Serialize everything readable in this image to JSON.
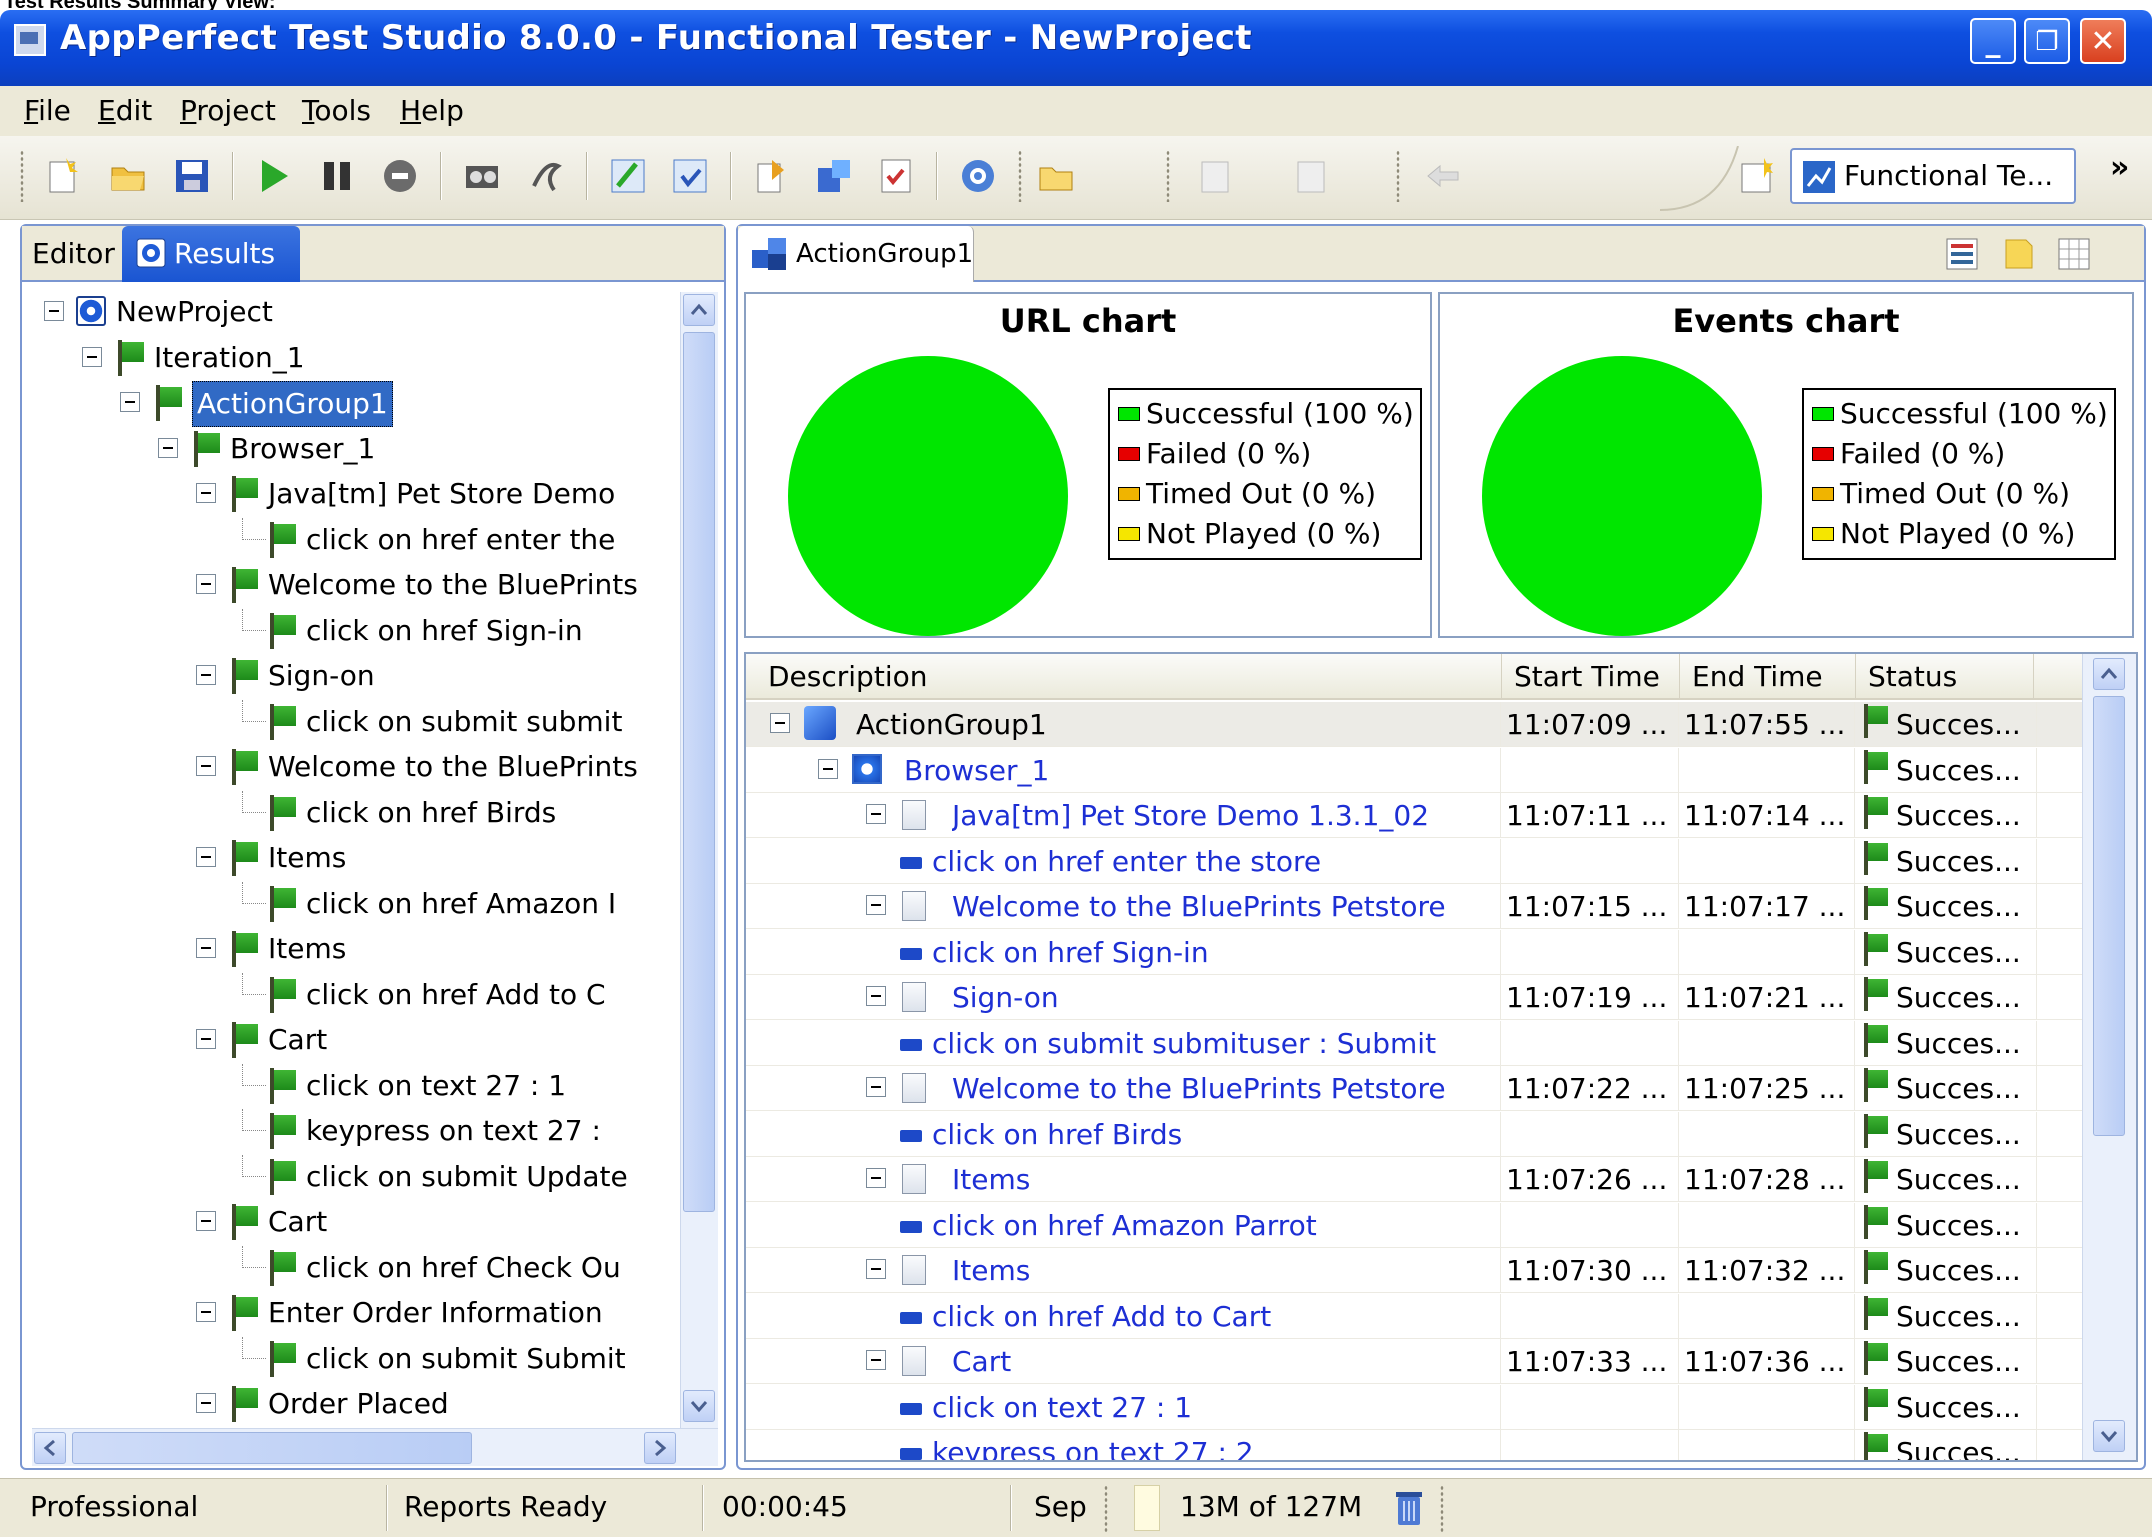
{
  "caption": "Test Results Summary View:",
  "window": {
    "title": "AppPerfect Test Studio 8.0.0 - Functional Tester - NewProject",
    "min_glyph": "_",
    "max_glyph": "❐",
    "close_glyph": "✕"
  },
  "menu": [
    "File",
    "Edit",
    "Project",
    "Tools",
    "Help"
  ],
  "toolbar": {
    "perspective_label": "Functional Te...",
    "overflow_glyph": "»"
  },
  "left_tabs": {
    "editor": "Editor",
    "results": "Results"
  },
  "tree": [
    {
      "label": "NewProject",
      "level": 0,
      "icon": "project-icon",
      "expander": true
    },
    {
      "label": "Iteration_1",
      "level": 1,
      "icon": "flag-icon",
      "expander": true
    },
    {
      "label": "ActionGroup1",
      "level": 2,
      "icon": "flag-icon",
      "expander": true,
      "selected": true
    },
    {
      "label": "Browser_1",
      "level": 3,
      "icon": "flag-icon",
      "expander": true
    },
    {
      "label": "Java[tm] Pet Store Demo",
      "level": 4,
      "icon": "flag-icon",
      "expander": true
    },
    {
      "label": "click on href enter the",
      "level": 5,
      "icon": "flag-icon",
      "expander": false
    },
    {
      "label": "Welcome to the BluePrints",
      "level": 4,
      "icon": "flag-icon",
      "expander": true
    },
    {
      "label": "click on href Sign-in",
      "level": 5,
      "icon": "flag-icon",
      "expander": false
    },
    {
      "label": "Sign-on",
      "level": 4,
      "icon": "flag-icon",
      "expander": true
    },
    {
      "label": "click on submit submit",
      "level": 5,
      "icon": "flag-icon",
      "expander": false
    },
    {
      "label": "Welcome to the BluePrints",
      "level": 4,
      "icon": "flag-icon",
      "expander": true
    },
    {
      "label": "click on href Birds",
      "level": 5,
      "icon": "flag-icon",
      "expander": false
    },
    {
      "label": "Items",
      "level": 4,
      "icon": "flag-icon",
      "expander": true
    },
    {
      "label": "click on href Amazon I",
      "level": 5,
      "icon": "flag-icon",
      "expander": false
    },
    {
      "label": "Items",
      "level": 4,
      "icon": "flag-icon",
      "expander": true
    },
    {
      "label": "click on href Add to C",
      "level": 5,
      "icon": "flag-icon",
      "expander": false
    },
    {
      "label": "Cart",
      "level": 4,
      "icon": "flag-icon",
      "expander": true
    },
    {
      "label": "click on text 27 : 1",
      "level": 5,
      "icon": "flag-icon",
      "expander": false
    },
    {
      "label": "keypress on text 27 :",
      "level": 5,
      "icon": "flag-icon",
      "expander": false
    },
    {
      "label": "click on submit Update",
      "level": 5,
      "icon": "flag-icon",
      "expander": false
    },
    {
      "label": "Cart",
      "level": 4,
      "icon": "flag-icon",
      "expander": true
    },
    {
      "label": "click on href Check Ou",
      "level": 5,
      "icon": "flag-icon",
      "expander": false
    },
    {
      "label": "Enter Order Information",
      "level": 4,
      "icon": "flag-icon",
      "expander": true
    },
    {
      "label": "click on submit Submit",
      "level": 5,
      "icon": "flag-icon",
      "expander": false
    },
    {
      "label": "Order Placed",
      "level": 4,
      "icon": "flag-icon",
      "expander": true
    }
  ],
  "right_tab": {
    "label": "ActionGroup1"
  },
  "charts": [
    {
      "title": "URL chart",
      "legend": [
        {
          "label": "Successful (100 %)",
          "color": "#00e600"
        },
        {
          "label": "Failed (0 %)",
          "color": "#e60000"
        },
        {
          "label": "Timed Out (0 %)",
          "color": "#f0b400"
        },
        {
          "label": "Not Played (0 %)",
          "color": "#f5e600"
        }
      ]
    },
    {
      "title": "Events chart",
      "legend": [
        {
          "label": "Successful (100 %)",
          "color": "#00e600"
        },
        {
          "label": "Failed (0 %)",
          "color": "#e60000"
        },
        {
          "label": "Timed Out (0 %)",
          "color": "#f0b400"
        },
        {
          "label": "Not Played (0 %)",
          "color": "#f5e600"
        }
      ]
    }
  ],
  "chart_data": [
    {
      "type": "pie",
      "title": "URL chart",
      "categories": [
        "Successful",
        "Failed",
        "Timed Out",
        "Not Played"
      ],
      "values": [
        100,
        0,
        0,
        0
      ],
      "colors": [
        "#00e600",
        "#e60000",
        "#f0b400",
        "#f5e600"
      ],
      "legend": "right"
    },
    {
      "type": "pie",
      "title": "Events chart",
      "categories": [
        "Successful",
        "Failed",
        "Timed Out",
        "Not Played"
      ],
      "values": [
        100,
        0,
        0,
        0
      ],
      "colors": [
        "#00e600",
        "#e60000",
        "#f0b400",
        "#f5e600"
      ],
      "legend": "right"
    }
  ],
  "table": {
    "columns": [
      "Description",
      "Start Time",
      "End Time",
      "Status"
    ],
    "rows": [
      {
        "desc": "ActionGroup1",
        "level": 0,
        "icon": "cube-icon",
        "expander": true,
        "start": "11:07:09 ...",
        "end": "11:07:55 ...",
        "status": "Succes..."
      },
      {
        "desc": "Browser_1",
        "level": 1,
        "icon": "browser-icon",
        "expander": true,
        "start": "",
        "end": "",
        "status": "Succes..."
      },
      {
        "desc": "Java[tm] Pet Store Demo 1.3.1_02",
        "level": 2,
        "icon": "page-icon",
        "expander": true,
        "start": "11:07:11 ...",
        "end": "11:07:14 ...",
        "status": "Succes..."
      },
      {
        "desc": "click on href enter the store",
        "level": 3,
        "icon": "event-icon",
        "expander": false,
        "start": "",
        "end": "",
        "status": "Succes..."
      },
      {
        "desc": "Welcome to the BluePrints Petstore",
        "level": 2,
        "icon": "page-icon",
        "expander": true,
        "start": "11:07:15 ...",
        "end": "11:07:17 ...",
        "status": "Succes..."
      },
      {
        "desc": "click on href Sign-in",
        "level": 3,
        "icon": "event-icon",
        "expander": false,
        "start": "",
        "end": "",
        "status": "Succes..."
      },
      {
        "desc": "Sign-on",
        "level": 2,
        "icon": "page-icon",
        "expander": true,
        "start": "11:07:19 ...",
        "end": "11:07:21 ...",
        "status": "Succes..."
      },
      {
        "desc": "click on submit submituser : Submit",
        "level": 3,
        "icon": "event-icon",
        "expander": false,
        "start": "",
        "end": "",
        "status": "Succes..."
      },
      {
        "desc": "Welcome to the BluePrints Petstore",
        "level": 2,
        "icon": "page-icon",
        "expander": true,
        "start": "11:07:22 ...",
        "end": "11:07:25 ...",
        "status": "Succes..."
      },
      {
        "desc": "click on href Birds",
        "level": 3,
        "icon": "event-icon",
        "expander": false,
        "start": "",
        "end": "",
        "status": "Succes..."
      },
      {
        "desc": "Items",
        "level": 2,
        "icon": "page-icon",
        "expander": true,
        "start": "11:07:26 ...",
        "end": "11:07:28 ...",
        "status": "Succes..."
      },
      {
        "desc": "click on href Amazon Parrot",
        "level": 3,
        "icon": "event-icon",
        "expander": false,
        "start": "",
        "end": "",
        "status": "Succes..."
      },
      {
        "desc": "Items",
        "level": 2,
        "icon": "page-icon",
        "expander": true,
        "start": "11:07:30 ...",
        "end": "11:07:32 ...",
        "status": "Succes..."
      },
      {
        "desc": "click on href Add to Cart",
        "level": 3,
        "icon": "event-icon",
        "expander": false,
        "start": "",
        "end": "",
        "status": "Succes..."
      },
      {
        "desc": "Cart",
        "level": 2,
        "icon": "page-icon",
        "expander": true,
        "start": "11:07:33 ...",
        "end": "11:07:36 ...",
        "status": "Succes..."
      },
      {
        "desc": "click on text 27 : 1",
        "level": 3,
        "icon": "event-icon",
        "expander": false,
        "start": "",
        "end": "",
        "status": "Succes..."
      },
      {
        "desc": "keypress on text 27 : 2",
        "level": 3,
        "icon": "event-icon",
        "expander": false,
        "start": "",
        "end": "",
        "status": "Succes..."
      }
    ]
  },
  "statusbar": {
    "edition": "Professional",
    "reports": "Reports Ready",
    "elapsed": "00:00:45",
    "sep": "Sep",
    "memory": "13M of 127M"
  }
}
